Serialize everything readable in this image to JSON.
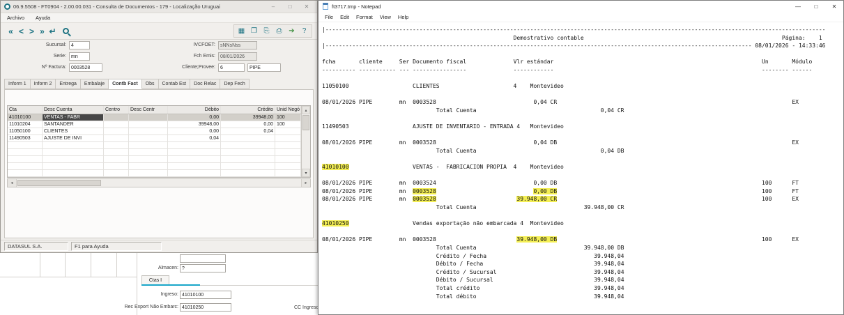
{
  "colors": {
    "highlight": "#f3ee54",
    "accent-teal": "#1d7382",
    "tab-underline": "#19a6c9",
    "selected-row": "#d2cfc9",
    "selected-cell": "#474747"
  },
  "erp": {
    "title": "06.9.5508 - FT0904 - 2.00.00.031 - Consulta de Documentos - 179 - Localização Uruguai",
    "window_buttons": {
      "minimize": "–",
      "maximize": "□",
      "close": "✕"
    },
    "menu": {
      "archivo": "Archivo",
      "ayuda": "Ayuda"
    },
    "toolbar": {
      "nav_first": "«",
      "nav_prev": "<",
      "nav_next": ">",
      "nav_last": "»",
      "nav_enter": "↵",
      "icon_grid": "▦",
      "icon_copy": "❐",
      "icon_doc": "⎘",
      "icon_print": "⎙",
      "icon_export": "➔",
      "icon_help": "?"
    },
    "form": {
      "sucursal": {
        "label": "Sucursal:",
        "value": "4"
      },
      "serie": {
        "label": "Serie:",
        "value": "mn"
      },
      "factura": {
        "label": "Nº Factura:",
        "value": "0003528"
      },
      "ivcfoet": {
        "label": "IVCFOET:",
        "value": "sNNsNss"
      },
      "fch_emis": {
        "label": "Fch Emis:",
        "value": "08/01/2026"
      },
      "cliente": {
        "label": "Cliente;Provee:",
        "value": "6",
        "name": "PIPE"
      }
    },
    "tabs": [
      "Inform 1",
      "Inform 2",
      "Entrega",
      "Embalaje",
      "Contb Fact",
      "Obs",
      "Contab Est",
      "Doc Relac",
      "Dep Fech"
    ],
    "active_tab": "Contb Fact",
    "grid": {
      "headers": [
        "Cta",
        "Desc Cuenta",
        "Centro",
        "Desc Centr",
        "Débito",
        "Crédito",
        "Unid Negó"
      ],
      "rows": [
        {
          "cta": "41010100",
          "desc": "VENTAS - FABR",
          "centro": "",
          "desc_centr": "",
          "debito": "0,00",
          "credito": "39948,00",
          "unid": "100"
        },
        {
          "cta": "11010204",
          "desc": "SANTANDER",
          "centro": "",
          "desc_centr": "",
          "debito": "39948,00",
          "credito": "0,00",
          "unid": "100"
        },
        {
          "cta": "11050100",
          "desc": "CLIENTES",
          "centro": "",
          "desc_centr": "",
          "debito": "0,00",
          "credito": "0,04",
          "unid": ""
        },
        {
          "cta": "11490503",
          "desc": "AJUSTE DE INVI",
          "centro": "",
          "desc_centr": "",
          "debito": "0,04",
          "credito": "",
          "unid": ""
        }
      ]
    },
    "scroll": {
      "up": "▴",
      "down": "▾",
      "left": "◂",
      "right": "▸"
    },
    "status": {
      "company": "DATASUL S.A.",
      "help": "F1 para Ayuda"
    }
  },
  "background_panel": {
    "almacen": {
      "label": "Almacen:",
      "value": "?"
    },
    "tab": "Ctas I",
    "ingreso": {
      "label": "Ingreso:",
      "value": "41010100"
    },
    "rec_export": {
      "label": "Rec Export Não Embarc:",
      "value": "41010250"
    },
    "cc_ingreso_label": "CC Ingreso E"
  },
  "notepad": {
    "title": "ft3717.tmp - Notepad",
    "window_buttons": {
      "minimize": "—",
      "maximize": "□",
      "close": "✕"
    },
    "menu": [
      "File",
      "Edit",
      "Format",
      "View",
      "Help"
    ],
    "report_lines": [
      [
        {
          "c": 0,
          "t": "|"
        },
        {
          "c": 1,
          "t": "-",
          "r": 149
        }
      ],
      [
        {
          "c": 57,
          "t": "Demostrativo contable"
        },
        {
          "c": 137,
          "t": "Página:"
        },
        {
          "c": 148,
          "t": "1"
        }
      ],
      [
        {
          "c": 0,
          "t": "|"
        },
        {
          "c": 1,
          "t": "-",
          "r": 127
        },
        {
          "c": 129,
          "t": "08/01/2026 - 14:33:46"
        }
      ],
      [],
      [
        {
          "c": 0,
          "t": "fcha"
        },
        {
          "c": 11,
          "t": "cliente"
        },
        {
          "c": 23,
          "t": "Ser"
        },
        {
          "c": 27,
          "t": "Documento fiscal"
        },
        {
          "c": 57,
          "t": "Vlr estándar"
        },
        {
          "c": 131,
          "t": "Un"
        },
        {
          "c": 140,
          "t": "Módulo"
        }
      ],
      [
        {
          "c": 0,
          "t": "-",
          "r": 10
        },
        {
          "c": 11,
          "t": "-",
          "r": 11
        },
        {
          "c": 23,
          "t": "-",
          "r": 3
        },
        {
          "c": 27,
          "t": "-",
          "r": 16
        },
        {
          "c": 57,
          "t": "-",
          "r": 12
        },
        {
          "c": 131,
          "t": "-",
          "r": 8
        },
        {
          "c": 140,
          "t": "-",
          "r": 6
        }
      ],
      [],
      [
        {
          "c": 0,
          "t": "11050100"
        },
        {
          "c": 27,
          "t": "CLIENTES"
        },
        {
          "c": 57,
          "t": "4"
        },
        {
          "c": 62,
          "t": "Montevideo"
        }
      ],
      [],
      [
        {
          "c": 0,
          "t": "08/01/2026 PIPE"
        },
        {
          "c": 23,
          "t": "mn"
        },
        {
          "c": 27,
          "t": "0003528"
        },
        {
          "c": 63,
          "t": "0,04 CR"
        },
        {
          "c": 140,
          "t": "EX"
        }
      ],
      [
        {
          "c": 34,
          "t": "Total Cuenta"
        },
        {
          "c": 83,
          "t": "0,04 CR"
        }
      ],
      [],
      [
        {
          "c": 0,
          "t": "11490503"
        },
        {
          "c": 27,
          "t": "AJUSTE DE INVENTARIO - ENTRADA"
        },
        {
          "c": 58,
          "t": "4"
        },
        {
          "c": 62,
          "t": "Montevideo"
        }
      ],
      [],
      [
        {
          "c": 0,
          "t": "08/01/2026 PIPE"
        },
        {
          "c": 23,
          "t": "mn"
        },
        {
          "c": 27,
          "t": "0003528"
        },
        {
          "c": 63,
          "t": "0,04 DB"
        },
        {
          "c": 140,
          "t": "EX"
        }
      ],
      [
        {
          "c": 34,
          "t": "Total Cuenta"
        },
        {
          "c": 83,
          "t": "0,04 DB"
        }
      ],
      [],
      [
        {
          "c": 0,
          "t": "41010100",
          "h": true
        },
        {
          "c": 27,
          "t": "VENTAS -  FABRICACION PROPIA"
        },
        {
          "c": 57,
          "t": "4"
        },
        {
          "c": 62,
          "t": "Montevideo"
        }
      ],
      [],
      [
        {
          "c": 0,
          "t": "08/01/2026 PIPE"
        },
        {
          "c": 23,
          "t": "mn"
        },
        {
          "c": 27,
          "t": "0003524"
        },
        {
          "c": 63,
          "t": "0,00 DB"
        },
        {
          "c": 131,
          "t": "100"
        },
        {
          "c": 140,
          "t": "FT"
        }
      ],
      [
        {
          "c": 0,
          "t": "08/01/2026 PIPE"
        },
        {
          "c": 23,
          "t": "mn"
        },
        {
          "c": 27,
          "t": "0003528",
          "h": true
        },
        {
          "c": 63,
          "t": "0,00 DB",
          "h": true
        },
        {
          "c": 131,
          "t": "100"
        },
        {
          "c": 140,
          "t": "FT"
        }
      ],
      [
        {
          "c": 0,
          "t": "08/01/2026 PIPE"
        },
        {
          "c": 23,
          "t": "mn"
        },
        {
          "c": 27,
          "t": "0003528",
          "h": true
        },
        {
          "c": 58,
          "t": "39.948,00 CR",
          "h": true
        },
        {
          "c": 131,
          "t": "100"
        },
        {
          "c": 140,
          "t": "EX"
        }
      ],
      [
        {
          "c": 34,
          "t": "Total Cuenta"
        },
        {
          "c": 78,
          "t": "39.948,00 CR"
        }
      ],
      [],
      [
        {
          "c": 0,
          "t": "41010250",
          "h": true
        },
        {
          "c": 27,
          "t": "Vendas exportação não embarcada"
        },
        {
          "c": 59,
          "t": "4"
        },
        {
          "c": 62,
          "t": "Montevideo"
        }
      ],
      [],
      [
        {
          "c": 0,
          "t": "08/01/2026 PIPE"
        },
        {
          "c": 23,
          "t": "mn"
        },
        {
          "c": 27,
          "t": "0003528"
        },
        {
          "c": 58,
          "t": "39.948,00 DB",
          "h": true
        },
        {
          "c": 131,
          "t": "100"
        },
        {
          "c": 140,
          "t": "EX"
        }
      ],
      [
        {
          "c": 34,
          "t": "Total Cuenta"
        },
        {
          "c": 78,
          "t": "39.948,00 DB"
        }
      ],
      [
        {
          "c": 34,
          "t": "Crédito / Fecha"
        },
        {
          "c": 81,
          "t": "39.948,04"
        }
      ],
      [
        {
          "c": 34,
          "t": "Débito / Fecha"
        },
        {
          "c": 81,
          "t": "39.948,04"
        }
      ],
      [
        {
          "c": 34,
          "t": "Crédito / Sucursal"
        },
        {
          "c": 81,
          "t": "39.948,04"
        }
      ],
      [
        {
          "c": 34,
          "t": "Débito / Sucursal"
        },
        {
          "c": 81,
          "t": "39.948,04"
        }
      ],
      [
        {
          "c": 34,
          "t": "Total crédito"
        },
        {
          "c": 81,
          "t": "39.948,04"
        }
      ],
      [
        {
          "c": 34,
          "t": "Total débito"
        },
        {
          "c": 81,
          "t": "39.948,04"
        }
      ]
    ]
  }
}
